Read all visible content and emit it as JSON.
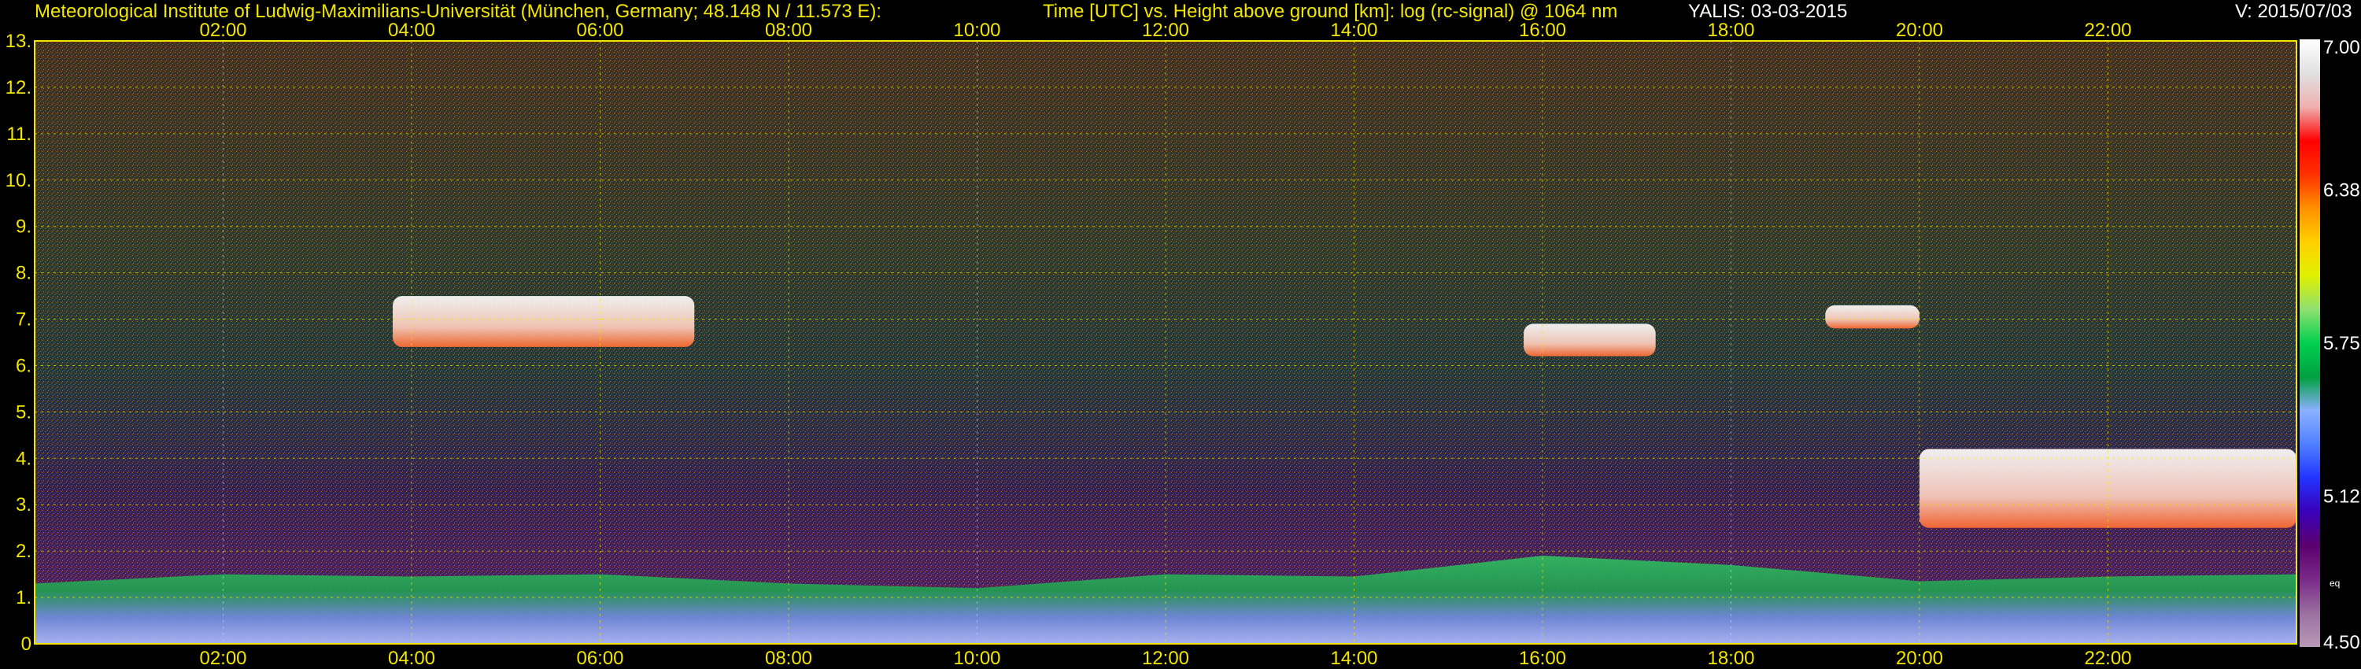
{
  "header": {
    "institute": "Meteorological Institute of Ludwig-Maximilians-Universität (München, Germany; 48.148 N / 11.573 E):",
    "description": "Time [UTC] vs. Height above ground [km]: log (rc-signal) @ 1064 nm",
    "station": "YALIS: 03-03-2015",
    "version": "V: 2015/07/03"
  },
  "chart_data": {
    "type": "heatmap",
    "title": "Time [UTC] vs. Height above ground [km]: log (rc-signal) @ 1064 nm",
    "xlabel": "Time [UTC]",
    "ylabel": "Height above ground [km]",
    "xlim": [
      "00:00",
      "24:00"
    ],
    "ylim": [
      0,
      13
    ],
    "x_tick_labels": [
      "02:00",
      "04:00",
      "06:00",
      "08:00",
      "10:00",
      "12:00",
      "14:00",
      "16:00",
      "18:00",
      "20:00",
      "22:00"
    ],
    "x_ticks_hours": [
      2,
      4,
      6,
      8,
      10,
      12,
      14,
      16,
      18,
      20,
      22
    ],
    "y_tick_labels": [
      "0",
      "1.",
      "2.",
      "3.",
      "4.",
      "5.",
      "6.",
      "7.",
      "8.",
      "9.",
      "10.",
      "11.",
      "12.",
      "13."
    ],
    "y_ticks_km": [
      0,
      1,
      2,
      3,
      4,
      5,
      6,
      7,
      8,
      9,
      10,
      11,
      12,
      13
    ],
    "grid": true,
    "grid_color": "#f2e600",
    "colorbar": {
      "range": [
        4.5,
        7.0
      ],
      "labels": [
        "7.00",
        "6.38",
        "5.75",
        "5.12",
        "4.50"
      ],
      "values": [
        7.0,
        6.38,
        5.75,
        5.12,
        4.5
      ],
      "unit_label": "eq",
      "colors_low_to_high": [
        "#b89ab8",
        "#9a6fa0",
        "#7a2a88",
        "#5a006e",
        "#3b00b8",
        "#2233ff",
        "#4f80ff",
        "#8cb0ff",
        "#00a040",
        "#00d050",
        "#8fe070",
        "#e0f000",
        "#ffd000",
        "#ff9000",
        "#ff3000",
        "#ff0000",
        "#f0b0b0",
        "#e0e0e0",
        "#ffffff"
      ]
    },
    "features": [
      {
        "name": "boundary layer",
        "t_start": 0.0,
        "t_end": 24.0,
        "z_bottom": 0.0,
        "z_top_profile": [
          [
            0,
            1.3
          ],
          [
            2,
            1.5
          ],
          [
            4,
            1.45
          ],
          [
            6,
            1.5
          ],
          [
            8,
            1.3
          ],
          [
            10,
            1.2
          ],
          [
            12,
            1.5
          ],
          [
            14,
            1.45
          ],
          [
            16,
            1.9
          ],
          [
            18,
            1.7
          ],
          [
            20,
            1.35
          ],
          [
            22,
            1.45
          ],
          [
            24,
            1.5
          ]
        ],
        "value": 5.7
      },
      {
        "name": "cirrus cloud",
        "t_start": 3.8,
        "t_end": 7.0,
        "z_bottom": 6.4,
        "z_top": 7.5,
        "value": 6.9
      },
      {
        "name": "cloud",
        "t_start": 15.8,
        "t_end": 17.2,
        "z_bottom": 6.2,
        "z_top": 6.9,
        "value": 6.9
      },
      {
        "name": "cloud",
        "t_start": 19.0,
        "t_end": 20.0,
        "z_bottom": 6.8,
        "z_top": 7.3,
        "value": 6.9
      },
      {
        "name": "cloud",
        "t_start": 20.0,
        "t_end": 24.0,
        "z_bottom": 2.5,
        "z_top": 4.2,
        "value": 6.9
      }
    ]
  }
}
